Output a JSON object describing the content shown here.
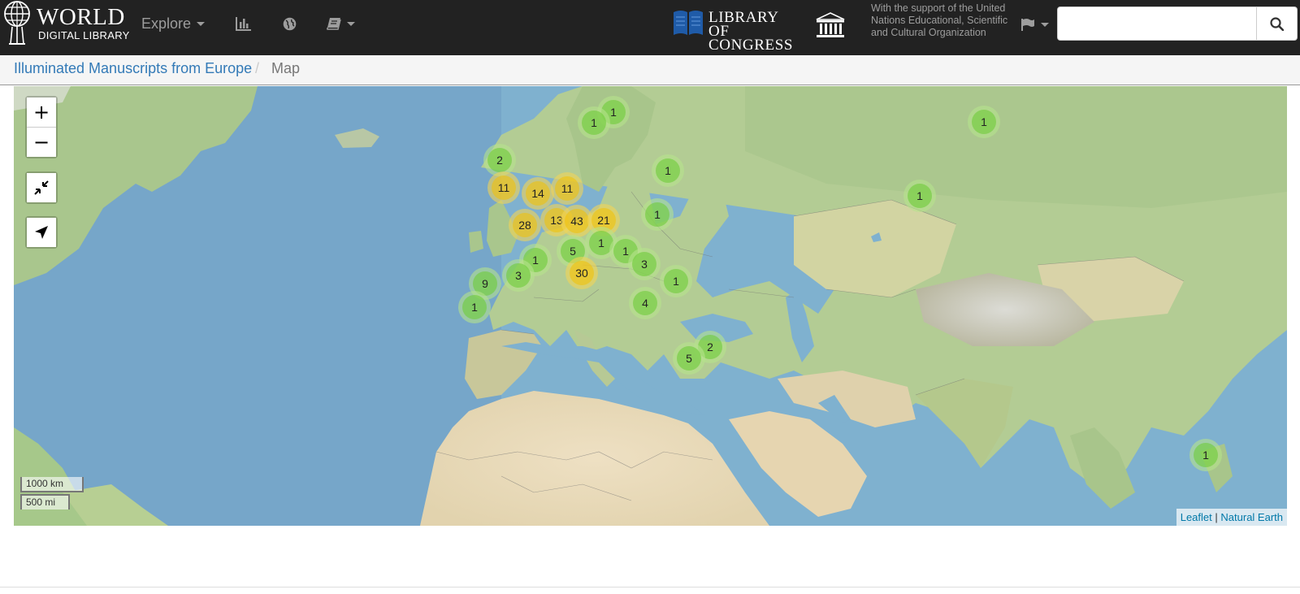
{
  "brand": {
    "title": "WORLD",
    "subtitle": "DIGITAL LIBRARY"
  },
  "nav": {
    "explore_label": "Explore",
    "stats_icon": "bar-chart-icon",
    "globe_icon": "globe-icon",
    "book_icon": "book-icon"
  },
  "partners": {
    "loc_line1": "LIBRARY OF",
    "loc_line2": "CONGRESS",
    "support_text": "With the support of the United Nations Educational, Scientific and Cultural Organization"
  },
  "search": {
    "value": "",
    "placeholder": ""
  },
  "breadcrumb": {
    "collection": "Illuminated Manuscripts from Europe",
    "separator": "/",
    "current": "Map"
  },
  "map": {
    "controls": {
      "zoom_in": "+",
      "zoom_out": "−"
    },
    "scale_km": "1000 km",
    "scale_mi": "500 mi",
    "attribution": {
      "leaflet": "Leaflet",
      "separator": "|",
      "natural_earth": "Natural Earth"
    },
    "clusters": [
      {
        "count": "1",
        "color": "green",
        "region": "sweden-south"
      },
      {
        "count": "1",
        "color": "green",
        "region": "denmark"
      },
      {
        "count": "1",
        "color": "green",
        "region": "western-siberia"
      },
      {
        "count": "2",
        "color": "green",
        "region": "england"
      },
      {
        "count": "1",
        "color": "green",
        "region": "poland"
      },
      {
        "count": "1",
        "color": "green",
        "region": "kazakhstan"
      },
      {
        "count": "11",
        "color": "yellow",
        "region": "southern-england"
      },
      {
        "count": "14",
        "color": "yellow",
        "region": "belgium"
      },
      {
        "count": "11",
        "color": "yellow",
        "region": "germany"
      },
      {
        "count": "28",
        "color": "yellow",
        "region": "france"
      },
      {
        "count": "13",
        "color": "yellow",
        "region": "eastern-france"
      },
      {
        "count": "43",
        "color": "yellow",
        "region": "switzerland"
      },
      {
        "count": "21",
        "color": "yellow",
        "region": "austria"
      },
      {
        "count": "1",
        "color": "green",
        "region": "ukraine"
      },
      {
        "count": "5",
        "color": "green",
        "region": "northern-italy"
      },
      {
        "count": "1",
        "color": "green",
        "region": "slovenia"
      },
      {
        "count": "1",
        "color": "green",
        "region": "southern-france"
      },
      {
        "count": "1",
        "color": "green",
        "region": "croatia"
      },
      {
        "count": "3",
        "color": "green",
        "region": "serbia"
      },
      {
        "count": "3",
        "color": "green",
        "region": "catalonia"
      },
      {
        "count": "30",
        "color": "yellow",
        "region": "italy"
      },
      {
        "count": "9",
        "color": "green",
        "region": "spain"
      },
      {
        "count": "1",
        "color": "green",
        "region": "turkey"
      },
      {
        "count": "1",
        "color": "green",
        "region": "southern-spain"
      },
      {
        "count": "4",
        "color": "green",
        "region": "greece"
      },
      {
        "count": "2",
        "color": "green",
        "region": "levant"
      },
      {
        "count": "5",
        "color": "green",
        "region": "egypt"
      },
      {
        "count": "1",
        "color": "green",
        "region": "philippines"
      }
    ]
  }
}
